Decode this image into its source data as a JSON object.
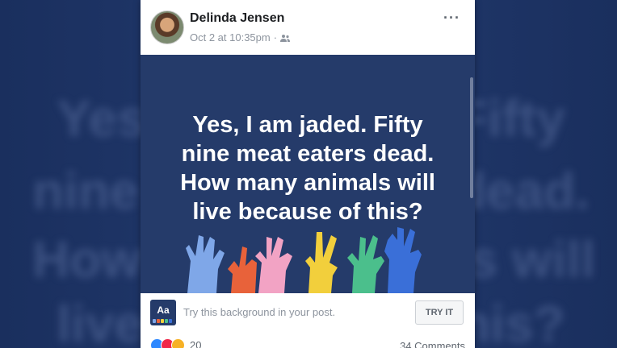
{
  "background_echo": [
    "Yes, I am jaded. Fifty",
    "nine meat eaters dead.",
    "How many animals will",
    "live because of this?"
  ],
  "post": {
    "author": "Delinda Jensen",
    "timestamp": "Oct 2 at 10:35pm",
    "separator": "·",
    "audience_icon": "friends-icon",
    "more_icon": "more-options-icon",
    "more_glyph": "···",
    "text_lines": [
      "Yes, I  am jaded. Fifty",
      "nine meat eaters dead.",
      "How many animals will",
      "live because of this?"
    ],
    "background_color": "#253b6a"
  },
  "try_background": {
    "thumb_label": "Aa",
    "prompt": "Try this background in your post.",
    "button_label": "TRY IT"
  },
  "footer": {
    "reaction_icons": [
      "like-icon",
      "love-icon",
      "haha-icon"
    ],
    "reaction_count": "20",
    "comments": "34 Comments"
  },
  "colors": {
    "page_background": "#1e3566",
    "card": "#ffffff",
    "author_text": "#1c1e21",
    "meta_text": "#8d949e",
    "hand_colors": [
      "#7fa7e8",
      "#e8623a",
      "#f2a3c4",
      "#f2cf3c",
      "#4bbf8c",
      "#3a6fd8"
    ]
  }
}
